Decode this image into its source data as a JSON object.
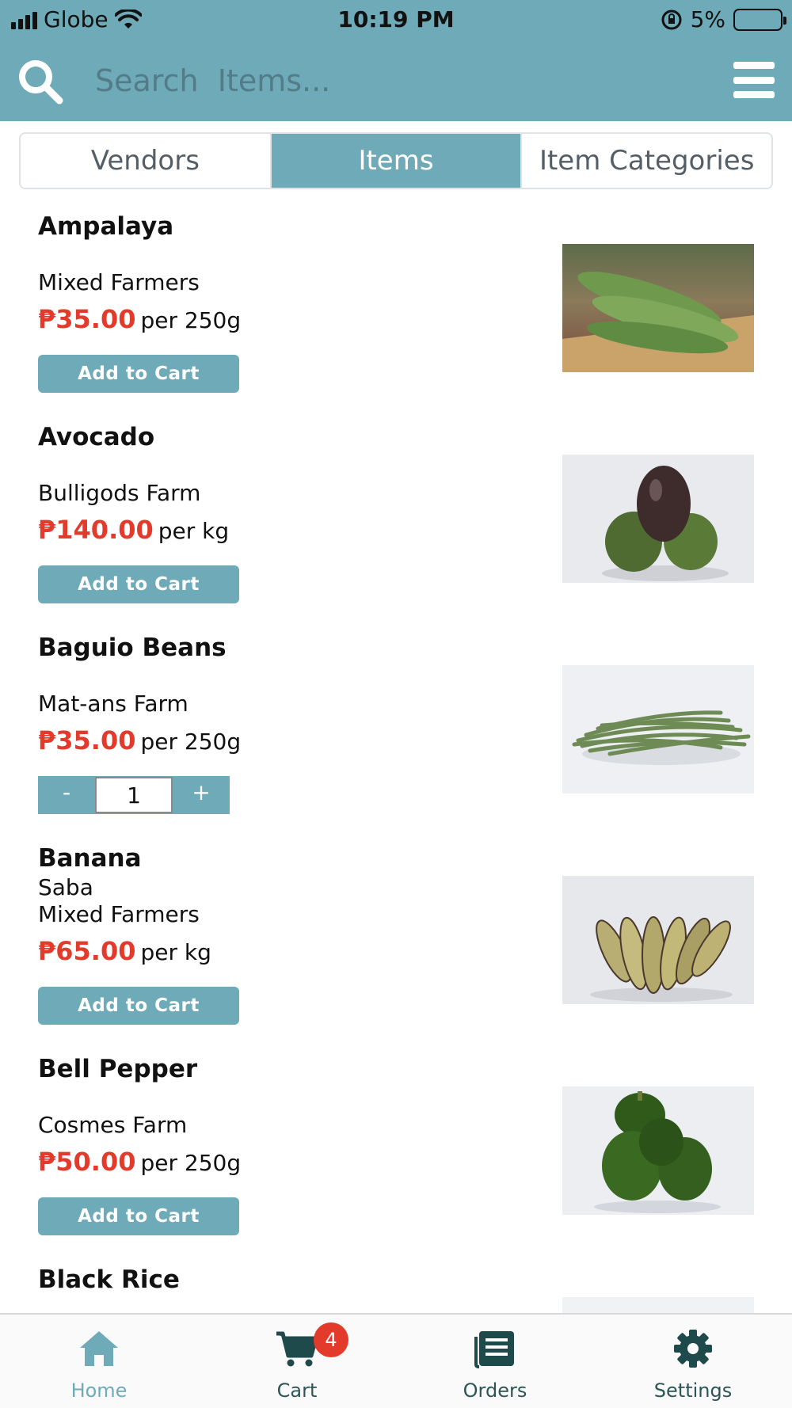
{
  "status_bar": {
    "carrier": "Globe",
    "time": "10:19 PM",
    "battery": "5%"
  },
  "search": {
    "placeholder": "Search  Items..."
  },
  "tabs": [
    {
      "label": "Vendors",
      "active": false
    },
    {
      "label": "Items",
      "active": true
    },
    {
      "label": "Item Categories",
      "active": false
    }
  ],
  "items": [
    {
      "name": "Ampalaya",
      "variant": "",
      "vendor": "Mixed Farmers",
      "price": "₱35.00",
      "unit": "per 250g",
      "action": "Add to Cart",
      "image": "bitter-gourd-photo"
    },
    {
      "name": "Avocado",
      "variant": "",
      "vendor": "Bulligods Farm",
      "price": "₱140.00",
      "unit": "per kg",
      "action": "Add to Cart",
      "image": "avocado-photo"
    },
    {
      "name": "Baguio Beans",
      "variant": "",
      "vendor": "Mat-ans Farm",
      "price": "₱35.00",
      "unit": "per 250g",
      "stepper": {
        "minus": "-",
        "qty": "1",
        "plus": "+"
      },
      "image": "green-beans-photo"
    },
    {
      "name": "Banana",
      "variant": "Saba",
      "vendor": "Mixed Farmers",
      "price": "₱65.00",
      "unit": "per kg",
      "action": "Add to Cart",
      "image": "banana-photo"
    },
    {
      "name": "Bell Pepper",
      "variant": "",
      "vendor": "Cosmes Farm",
      "price": "₱50.00",
      "unit": "per 250g",
      "action": "Add to Cart",
      "image": "bell-pepper-photo"
    },
    {
      "name": "Black Rice",
      "variant": "",
      "vendor": "",
      "price": "",
      "unit": "",
      "image": "black-rice-photo"
    }
  ],
  "tabbar": [
    {
      "label": "Home",
      "icon": "home-icon",
      "active": true
    },
    {
      "label": "Cart",
      "icon": "cart-icon",
      "badge": "4"
    },
    {
      "label": "Orders",
      "icon": "orders-icon"
    },
    {
      "label": "Settings",
      "icon": "gear-icon"
    }
  ],
  "colors": {
    "accent": "#6eaab8",
    "price": "#e23b2c",
    "badge": "#e23b2c"
  }
}
